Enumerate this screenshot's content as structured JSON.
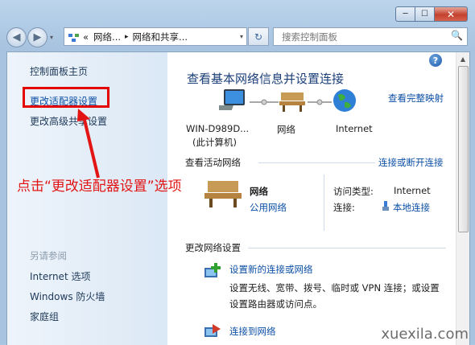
{
  "window": {
    "controls": {
      "minimize": "─",
      "maximize": "☐",
      "close": "✕"
    }
  },
  "nav": {
    "back_icon": "◀",
    "forward_icon": "▶",
    "dropdown_icon": "▾",
    "refresh_icon": "↻"
  },
  "address": {
    "chevrons": "«",
    "crumb1": "网络...",
    "sep": "▸",
    "crumb2": "网络和共享..."
  },
  "search": {
    "placeholder": "搜索控制面板",
    "icon": "🔍"
  },
  "sidebar": {
    "home": "控制面板主页",
    "adapter": "更改适配器设置",
    "advanced": "更改高级共享设置",
    "see_also": "另请参阅",
    "see1": "Internet 选项",
    "see2": "Windows 防火墙",
    "see3": "家庭组"
  },
  "annotation": {
    "text": "点击“更改适配器设置”选项"
  },
  "main": {
    "title": "查看基本网络信息并设置连接",
    "full_map": "查看完整映射",
    "node_computer": "WIN-D989D...",
    "node_computer_sub": "(此计算机)",
    "node_network": "网络",
    "node_internet": "Internet",
    "active_header": "查看活动网络",
    "connect_link": "连接或断开连接",
    "net_name": "网络",
    "net_type": "公用网络",
    "access_label": "访问类型:",
    "access_value": "Internet",
    "conn_label": "连接:",
    "conn_value": "本地连接",
    "change_header": "更改网络设置",
    "setup_link": "设置新的连接或网络",
    "setup_desc1": "设置无线、宽带、拨号、临时或 VPN 连接；或设置",
    "setup_desc2": "设置路由器或访问点。",
    "connect_to": "连接到网络",
    "help": "?"
  },
  "watermark": "xuexila.com",
  "colors": {
    "link": "#0c4fa5",
    "annotation": "#e31414",
    "title": "#1b3f78"
  }
}
